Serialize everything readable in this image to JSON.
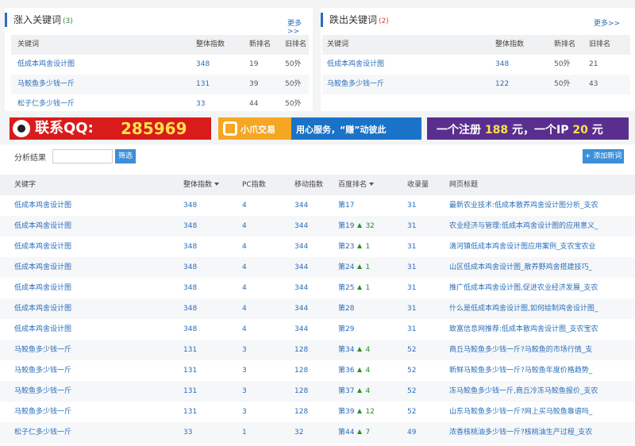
{
  "rise_panel": {
    "title": "涨入关键词",
    "count": "(3)",
    "more": "更多>>",
    "headers": [
      "关键词",
      "整体指数",
      "新排名",
      "旧排名"
    ],
    "rows": [
      [
        "低成本鸡舍设计图",
        "348",
        "19",
        "50外"
      ],
      [
        "马鲛鱼多少钱一斤",
        "131",
        "39",
        "50外"
      ],
      [
        "松子仁多少钱一斤",
        "33",
        "44",
        "50外"
      ]
    ]
  },
  "fall_panel": {
    "title": "跌出关键词",
    "count": "(2)",
    "more": "更多>>",
    "headers": [
      "关键词",
      "整体指数",
      "新排名",
      "旧排名"
    ],
    "rows": [
      [
        "低成本鸡舍设计图",
        "348",
        "50外",
        "21"
      ],
      [
        "马鲛鱼多少钱一斤",
        "122",
        "50外",
        "43"
      ]
    ]
  },
  "ads": {
    "qq_label": "联系QQ:",
    "qq_number": "285969",
    "brand": "小爪交易",
    "slogan": "用心服务，“赚”动彼此",
    "ip_text_1": "一个注册",
    "ip_price_1": "188",
    "ip_text_2": "元，一个IP",
    "ip_price_2": "20",
    "ip_text_3": "元"
  },
  "results": {
    "label": "分析结果",
    "input_placeholder": "",
    "filter_button": "筛选",
    "add_button": "+ 添加新词",
    "headers": [
      "关键字",
      "整体指数",
      "PC指数",
      "移动指数",
      "百度排名",
      "收录量",
      "网页标题"
    ],
    "rows": [
      {
        "kw": "低成本鸡舍设计图",
        "total": "348",
        "pc": "4",
        "mobile": "344",
        "rank": "第17",
        "change": "",
        "count": "31",
        "title": "最新农业技术:低成本散养鸡舍设计图分析_支农"
      },
      {
        "kw": "低成本鸡舍设计图",
        "total": "348",
        "pc": "4",
        "mobile": "344",
        "rank": "第19",
        "change": "32",
        "count": "31",
        "title": "农业经济与管理:低成本鸡舍设计图的应用意义_"
      },
      {
        "kw": "低成本鸡舍设计图",
        "total": "348",
        "pc": "4",
        "mobile": "344",
        "rank": "第23",
        "change": "1",
        "count": "31",
        "title": "滴河镇低成本鸡舍设计图应用案例_支农宝农业"
      },
      {
        "kw": "低成本鸡舍设计图",
        "total": "348",
        "pc": "4",
        "mobile": "344",
        "rank": "第24",
        "change": "1",
        "count": "31",
        "title": "山区低成本鸡舍设计图_散养野鸡舍搭建技巧_"
      },
      {
        "kw": "低成本鸡舍设计图",
        "total": "348",
        "pc": "4",
        "mobile": "344",
        "rank": "第25",
        "change": "1",
        "count": "31",
        "title": "推广低成本鸡舍设计图,促进农业经济发展_支农"
      },
      {
        "kw": "低成本鸡舍设计图",
        "total": "348",
        "pc": "4",
        "mobile": "344",
        "rank": "第28",
        "change": "",
        "count": "31",
        "title": "什么是低成本鸡舍设计图,如何绘制鸡舍设计图_"
      },
      {
        "kw": "低成本鸡舍设计图",
        "total": "348",
        "pc": "4",
        "mobile": "344",
        "rank": "第29",
        "change": "",
        "count": "31",
        "title": "致富信息网推荐:低成本散鸡舍设计图_支农宝农"
      },
      {
        "kw": "马鲛鱼多少钱一斤",
        "total": "131",
        "pc": "3",
        "mobile": "128",
        "rank": "第34",
        "change": "4",
        "count": "52",
        "title": "商丘马鲛鱼多少钱一斤?马鲛鱼的市场行情_支"
      },
      {
        "kw": "马鲛鱼多少钱一斤",
        "total": "131",
        "pc": "3",
        "mobile": "128",
        "rank": "第36",
        "change": "4",
        "count": "52",
        "title": "新鲜马鲛鱼多少钱一斤?马鲛鱼年度价格趋势_"
      },
      {
        "kw": "马鲛鱼多少钱一斤",
        "total": "131",
        "pc": "3",
        "mobile": "128",
        "rank": "第37",
        "change": "4",
        "count": "52",
        "title": "冻马鲛鱼多少钱一斤,商丘冷冻马鲛鱼报价_支农"
      },
      {
        "kw": "马鲛鱼多少钱一斤",
        "total": "131",
        "pc": "3",
        "mobile": "128",
        "rank": "第39",
        "change": "12",
        "count": "52",
        "title": "山东马鲛鱼多少钱一斤?网上买马鲛鱼靠谱吗_"
      },
      {
        "kw": "松子仁多少钱一斤",
        "total": "33",
        "pc": "1",
        "mobile": "32",
        "rank": "第44",
        "change": "7",
        "count": "49",
        "title": "浓香核桃油多少钱一斤?核桃油生产过程_支农"
      }
    ]
  },
  "colors": {
    "accent": "#2a6ebb",
    "rise": "#2e8b2e",
    "fall": "#d43f3a",
    "button": "#3b8ed8"
  }
}
